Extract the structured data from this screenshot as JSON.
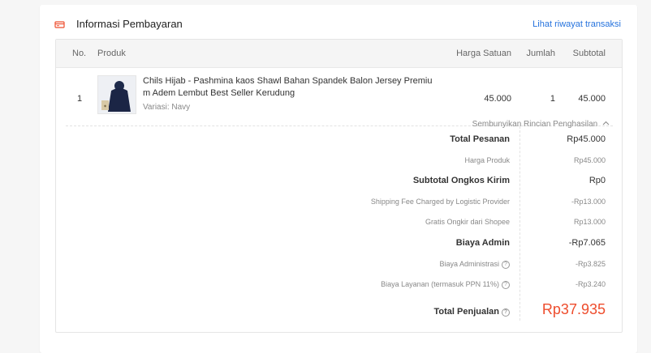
{
  "header": {
    "title": "Informasi Pembayaran",
    "link": "Lihat riwayat transaksi"
  },
  "table": {
    "columns": [
      "No.",
      "Produk",
      "Harga Satuan",
      "Jumlah",
      "Subtotal"
    ],
    "rows": [
      {
        "no": "1",
        "product_name": "Chils Hijab - Pashmina kaos Shawl Bahan Spandek Balon Jersey Premiu m Adem Lembut Best Seller Kerudung",
        "variant": "Variasi: Navy",
        "unit_price": "45.000",
        "qty": "1",
        "subtotal": "45.000"
      }
    ]
  },
  "toggle_label": "Sembunyikan Rincian Penghasilan",
  "summary": {
    "total_pesanan": {
      "label": "Total Pesanan",
      "value": "Rp45.000"
    },
    "harga_produk": {
      "label": "Harga Produk",
      "value": "Rp45.000"
    },
    "subtotal_ongkir": {
      "label": "Subtotal Ongkos Kirim",
      "value": "Rp0"
    },
    "shipping_fee": {
      "label": "Shipping Fee Charged by Logistic Provider",
      "value": "-Rp13.000"
    },
    "gratis_ongkir": {
      "label": "Gratis Ongkir dari Shopee",
      "value": "Rp13.000"
    },
    "biaya_admin": {
      "label": "Biaya Admin",
      "value": "-Rp7.065"
    },
    "biaya_administrasi": {
      "label": "Biaya Administrasi",
      "value": "-Rp3.825"
    },
    "biaya_layanan": {
      "label": "Biaya Layanan (termasuk PPN 11%)",
      "value": "-Rp3.240"
    },
    "total_penjualan": {
      "label": "Total Penjualan",
      "value": "Rp37.935"
    }
  },
  "colors": {
    "accent": "#ee4d2d",
    "link": "#2673dd"
  },
  "icons": {
    "header": "payment-card-icon",
    "toggle": "chevron-up-icon",
    "help": "question-circle-icon"
  }
}
